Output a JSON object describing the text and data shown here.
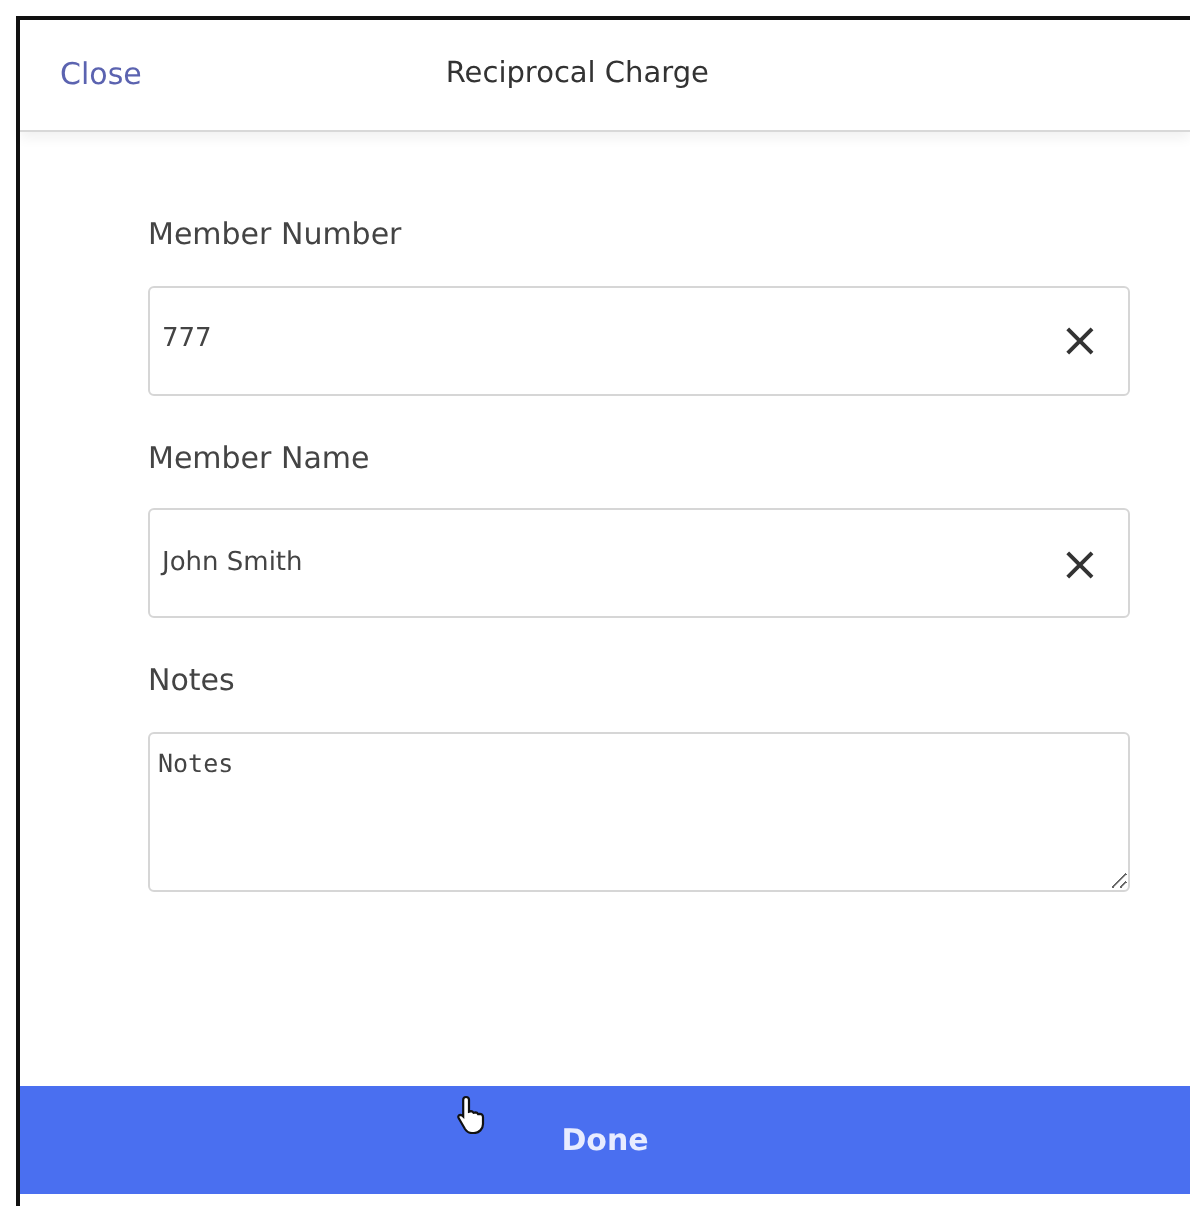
{
  "header": {
    "close": "Close",
    "title": "Reciprocal Charge"
  },
  "fields": [
    {
      "kind": "input",
      "label": "Member Number",
      "value": "777",
      "clear": "×"
    },
    {
      "kind": "input",
      "label": "Member Name",
      "value": "John Smith",
      "clear": "×"
    },
    {
      "kind": "textarea",
      "label": "Notes",
      "value": "Notes"
    }
  ],
  "done": "Done"
}
